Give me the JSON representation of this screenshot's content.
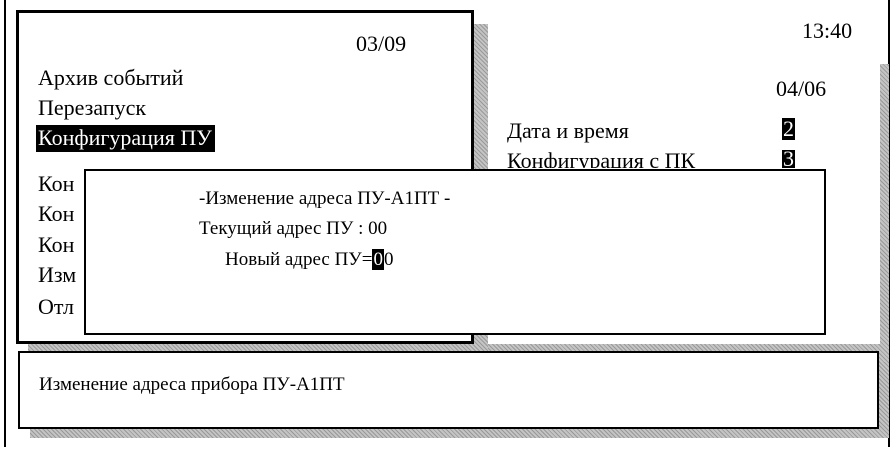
{
  "status_bar": {
    "clock": "13:40"
  },
  "main_menu": {
    "page_indicator": "03/09",
    "items": [
      "Архив событий",
      "Перезапуск",
      "Конфигурация ПУ",
      "Кон",
      "Кон",
      "Кон",
      "Изм",
      "Отл"
    ]
  },
  "config_menu": {
    "page_indicator": "04/06",
    "items": [
      {
        "label": "Дата и время",
        "key": "2"
      },
      {
        "label": "Конфигурация с ПК",
        "key": "3"
      }
    ]
  },
  "dialog": {
    "title": "-Изменение адреса ПУ-А1ПТ -",
    "current_address_label": "Текущий адрес ПУ : 00",
    "new_address_label": "Новый адрес ПУ=",
    "new_address_cursor_digit": "0",
    "new_address_rest": "0"
  },
  "help_bar": {
    "text": "Изменение адреса прибора ПУ-А1ПТ"
  }
}
